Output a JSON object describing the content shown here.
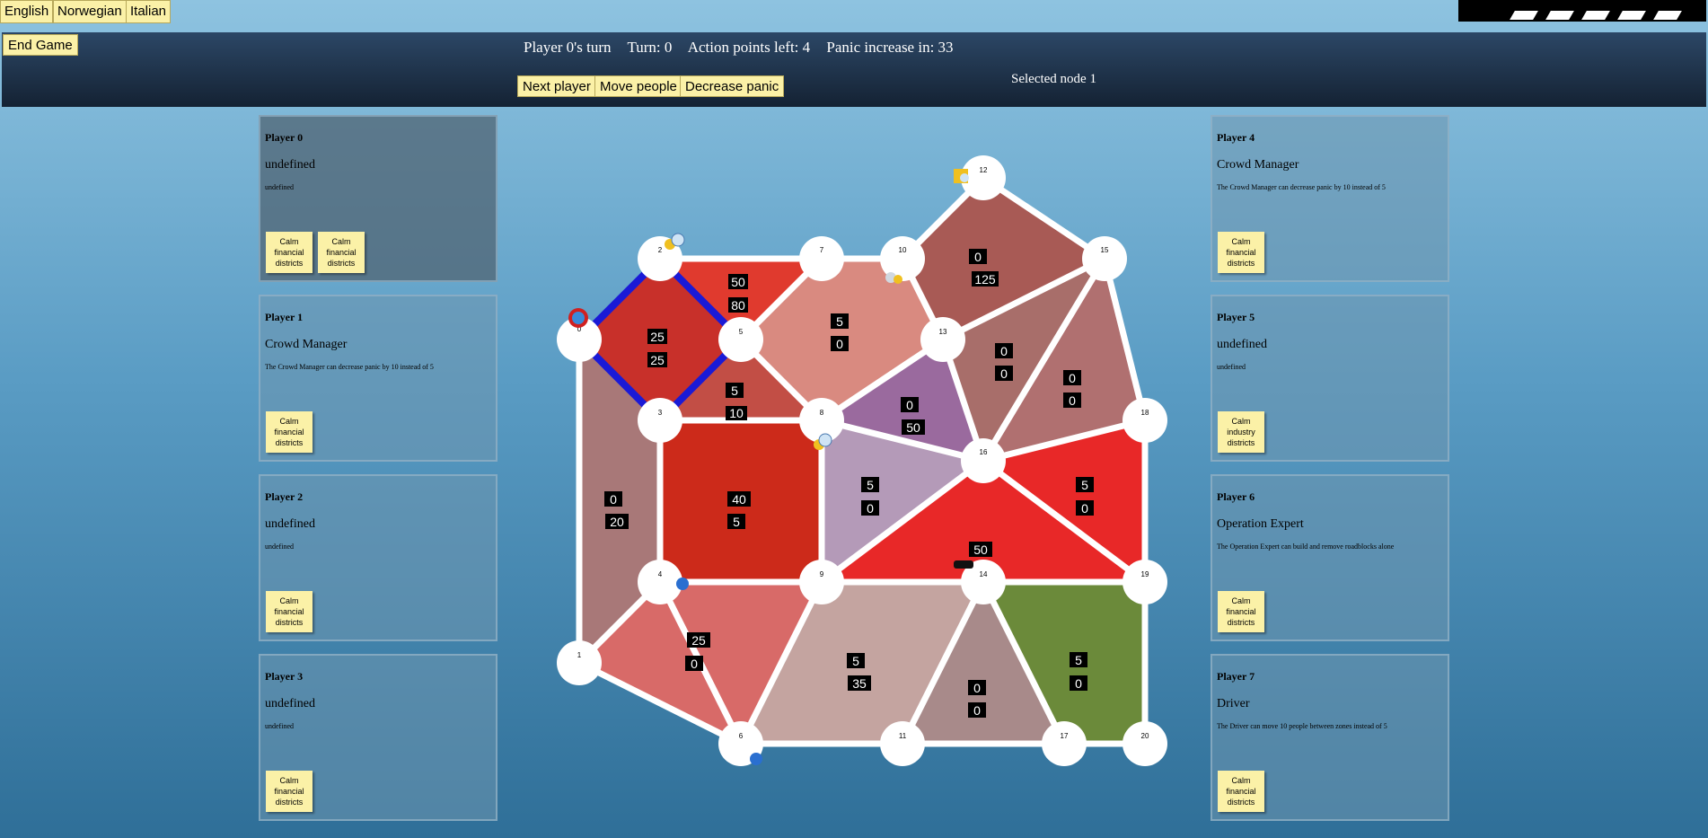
{
  "languages": [
    "English",
    "Norwegian",
    "Italian"
  ],
  "header": {
    "end_game": "End Game",
    "status": {
      "turn_player": "Player 0's turn",
      "turn": "Turn: 0",
      "action_points": "Action points left: 4",
      "panic_increase": "Panic increase in: 33"
    },
    "actions": [
      "Next player",
      "Move people",
      "Decrease panic"
    ],
    "selected_node": "Selected node 1"
  },
  "players": [
    {
      "name": "Player 0",
      "role": "undefined",
      "desc": "undefined",
      "cards": [
        "Calm financial districts",
        "Calm financial districts"
      ]
    },
    {
      "name": "Player 1",
      "role": "Crowd Manager",
      "desc": "The Crowd Manager can decrease panic by 10 instead of 5",
      "cards": [
        "Calm financial districts"
      ]
    },
    {
      "name": "Player 2",
      "role": "undefined",
      "desc": "undefined",
      "cards": [
        "Calm financial districts"
      ]
    },
    {
      "name": "Player 3",
      "role": "undefined",
      "desc": "undefined",
      "cards": [
        "Calm financial districts"
      ]
    },
    {
      "name": "Player 4",
      "role": "Crowd Manager",
      "desc": "The Crowd Manager can decrease panic by 10 instead of 5",
      "cards": [
        "Calm financial districts"
      ]
    },
    {
      "name": "Player 5",
      "role": "undefined",
      "desc": "undefined",
      "cards": [
        "Calm industry districts"
      ]
    },
    {
      "name": "Player 6",
      "role": "Operation Expert",
      "desc": "The Operation Expert can build and remove roadblocks alone",
      "cards": [
        "Calm financial districts"
      ]
    },
    {
      "name": "Player 7",
      "role": "Driver",
      "desc": "The Driver can move 10 people between zones instead of 5",
      "cards": [
        "Calm financial districts"
      ]
    }
  ],
  "board": {
    "nodes": [
      "0",
      "1",
      "2",
      "3",
      "4",
      "5",
      "6",
      "7",
      "8",
      "9",
      "10",
      "11",
      "12",
      "13",
      "14",
      "15",
      "16",
      "17",
      "18",
      "19",
      "20"
    ],
    "zone_values": [
      [
        "50",
        "80"
      ],
      [
        "25",
        "25"
      ],
      [
        "5",
        "0"
      ],
      [
        "0",
        "125"
      ],
      [
        "0",
        "0"
      ],
      [
        "0",
        "0"
      ],
      [
        "5",
        "10"
      ],
      [
        "0",
        "50"
      ],
      [
        "0",
        "20"
      ],
      [
        "40",
        "5"
      ],
      [
        "5",
        "0"
      ],
      [
        "5",
        "0"
      ],
      [
        "50"
      ],
      [
        "25",
        "0"
      ],
      [
        "5",
        "35"
      ],
      [
        "0",
        "0"
      ],
      [
        "5",
        "0"
      ]
    ],
    "colors": {
      "road": "#ffffff",
      "highlight_road": "#1a1ad6",
      "panic_zone": "#e02020"
    }
  }
}
